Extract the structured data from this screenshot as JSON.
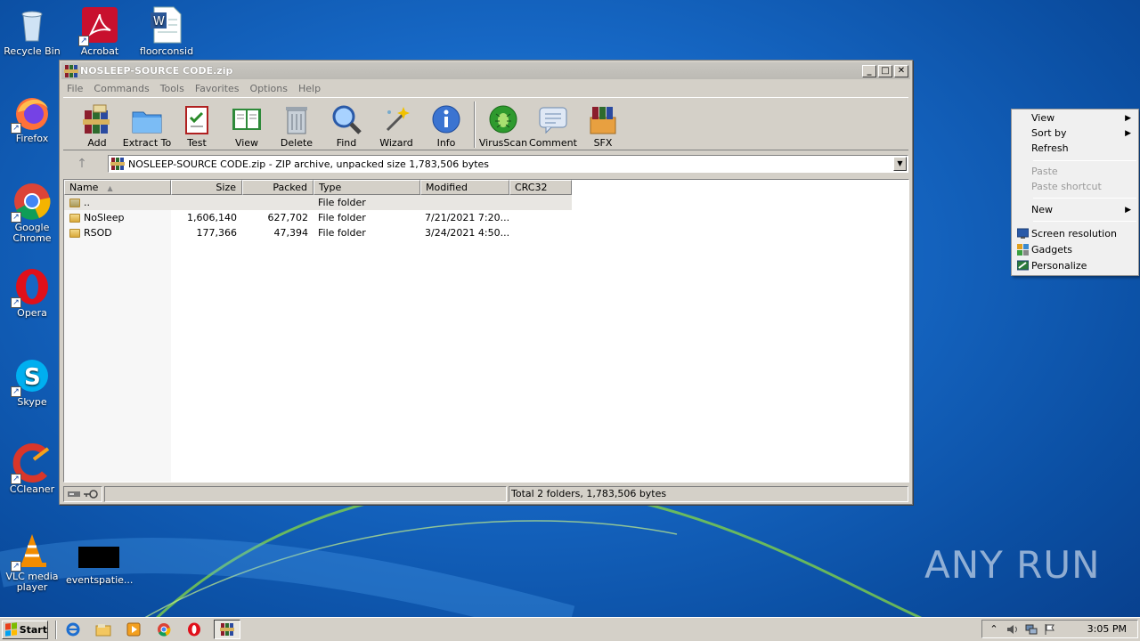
{
  "desktop": {
    "icons": [
      {
        "label": "Recycle Bin"
      },
      {
        "label": "Acrobat"
      },
      {
        "label": "floorconsid"
      },
      {
        "label": "Firefox"
      },
      {
        "label": "Google Chrome"
      },
      {
        "label": "Opera"
      },
      {
        "label": "Skype"
      },
      {
        "label": "CCleaner"
      },
      {
        "label": "VLC media player"
      },
      {
        "label": "eventspatie..."
      }
    ],
    "watermark": "ANY RUN"
  },
  "window": {
    "title": "NOSLEEP-SOURCE CODE.zip",
    "controls": {
      "minimize": "_",
      "maximize": "□",
      "close": "✕"
    },
    "menu": [
      "File",
      "Commands",
      "Tools",
      "Favorites",
      "Options",
      "Help"
    ],
    "toolbar": [
      {
        "label": "Add",
        "icon": "add-archive-icon"
      },
      {
        "label": "Extract To",
        "icon": "extract-folder-icon"
      },
      {
        "label": "Test",
        "icon": "test-clipboard-icon"
      },
      {
        "label": "View",
        "icon": "view-book-icon"
      },
      {
        "label": "Delete",
        "icon": "trash-icon"
      },
      {
        "label": "Find",
        "icon": "magnifier-icon"
      },
      {
        "label": "Wizard",
        "icon": "wand-icon"
      },
      {
        "label": "Info",
        "icon": "info-icon"
      },
      {
        "label": "VirusScan",
        "icon": "virus-scan-icon"
      },
      {
        "label": "Comment",
        "icon": "comment-icon"
      },
      {
        "label": "SFX",
        "icon": "sfx-box-icon"
      }
    ],
    "address": "NOSLEEP-SOURCE CODE.zip - ZIP archive, unpacked size 1,783,506 bytes",
    "columns": [
      "Name",
      "Size",
      "Packed",
      "Type",
      "Modified",
      "CRC32"
    ],
    "rows": [
      {
        "name": "..",
        "size": "",
        "packed": "",
        "type": "File folder",
        "modified": "",
        "crc": ""
      },
      {
        "name": "NoSleep",
        "size": "1,606,140",
        "packed": "627,702",
        "type": "File folder",
        "modified": "7/21/2021 7:20...",
        "crc": ""
      },
      {
        "name": "RSOD",
        "size": "177,366",
        "packed": "47,394",
        "type": "File folder",
        "modified": "3/24/2021 4:50...",
        "crc": ""
      }
    ],
    "status": "Total 2 folders, 1,783,506 bytes"
  },
  "context_menu": {
    "items": [
      {
        "label": "View",
        "submenu": true,
        "disabled": false
      },
      {
        "label": "Sort by",
        "submenu": true,
        "disabled": false
      },
      {
        "label": "Refresh",
        "submenu": false,
        "disabled": false
      },
      {
        "label": "Paste",
        "submenu": false,
        "disabled": true
      },
      {
        "label": "Paste shortcut",
        "submenu": false,
        "disabled": true
      },
      {
        "label": "New",
        "submenu": true,
        "disabled": false
      },
      {
        "label": "Screen resolution",
        "submenu": false,
        "disabled": false
      },
      {
        "label": "Gadgets",
        "submenu": false,
        "disabled": false
      },
      {
        "label": "Personalize",
        "submenu": false,
        "disabled": false
      }
    ],
    "arrow": "▶"
  },
  "taskbar": {
    "start_label": "Start",
    "clock": "3:05 PM"
  },
  "colors": {
    "desktop": "#1667c4",
    "window_face": "#d4d0c8",
    "menu_bg": "#f0f0f0"
  }
}
